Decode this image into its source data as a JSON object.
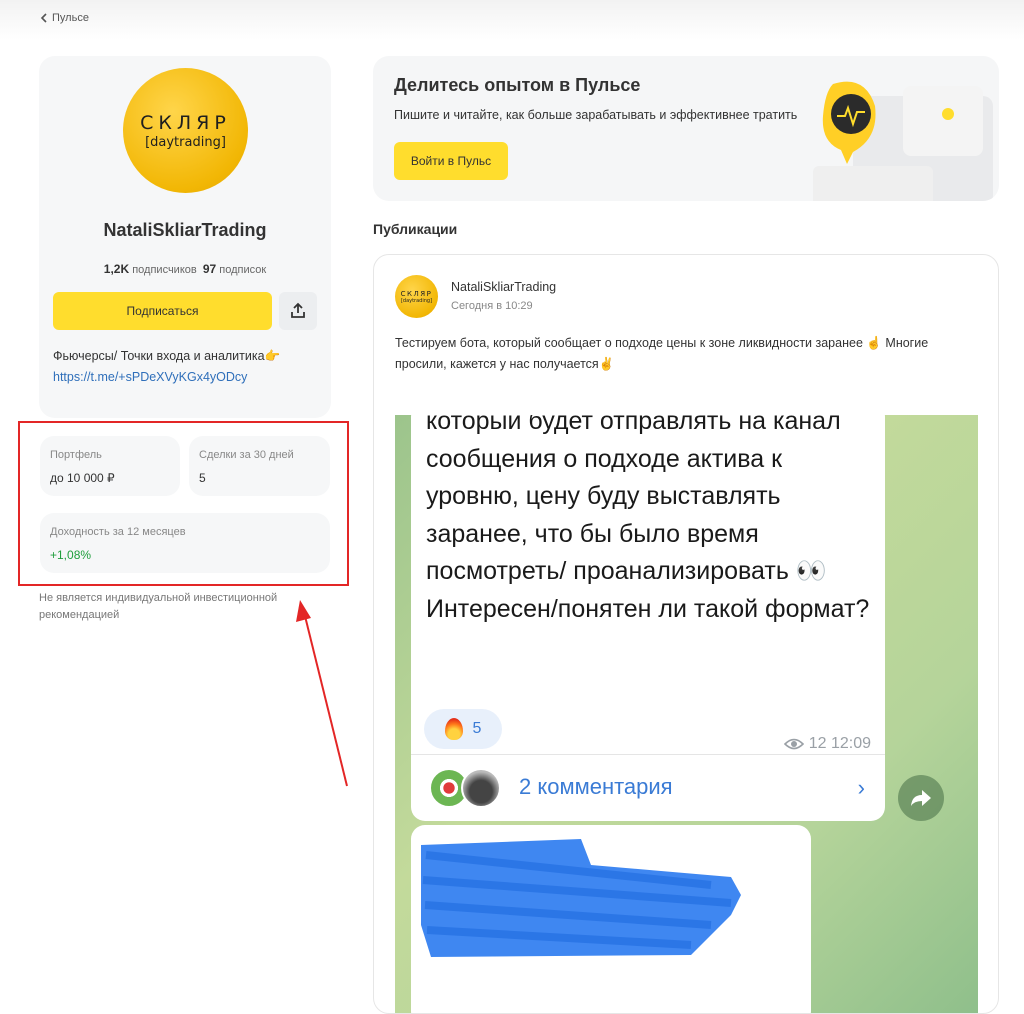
{
  "nav": {
    "back_label": "Пульсе"
  },
  "profile": {
    "avatar_line1": "СКЛЯР",
    "avatar_line2": "[daytrading]",
    "name": "NataliSkliarTrading",
    "followers_count": "1,2K",
    "followers_label": "подписчиков",
    "following_count": "97",
    "following_label": "подписок",
    "subscribe_label": "Подписаться",
    "bio": "Фьючерсы/ Точки входа и аналитика👉",
    "link": "https://t.me/+sPDeXVyKGx4yODcy"
  },
  "stats": {
    "portfolio_label": "Портфель",
    "portfolio_value": "до 10 000 ₽",
    "deals_label": "Сделки за 30 дней",
    "deals_value": "5",
    "yield_label": "Доходность за 12 месяцев",
    "yield_value": "+1,08%"
  },
  "disclaimer": "Не является индивидуальной инвестиционной рекомендацией",
  "promo": {
    "title": "Делитесь опытом в Пульсе",
    "description": "Пишите и читайте, как больше зарабатывать и эффективнее тратить",
    "button_label": "Войти в Пульс"
  },
  "section_title": "Публикации",
  "post": {
    "author": "NataliSkliarTrading",
    "time": "Сегодня в 10:29",
    "text": "Тестируем бота, который сообщает о подходе цены к зоне ликвидности заранее ☝ Многие просили, кажется у нас получается✌",
    "telegram": {
      "message": "который будет отправлять на канал сообщения о подходе актива к уровню, цену буду выставлять заранее, что бы было время посмотреть/ проанализировать 👀 Интересен/понятен ли такой формат?",
      "reaction_count": "5",
      "views_time": "12 12:09",
      "comments_label": "2 комментария"
    }
  },
  "colors": {
    "accent_yellow": "#ffdd2d",
    "link_blue": "#2f6fba",
    "positive_green": "#1f9e3c",
    "highlight_red": "#e32626"
  }
}
